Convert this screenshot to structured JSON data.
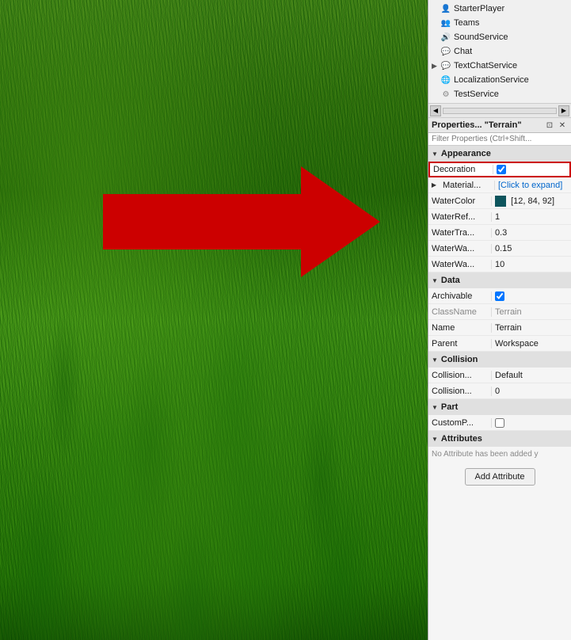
{
  "grass": {
    "alt": "Grass terrain background"
  },
  "explorer": {
    "items": [
      {
        "id": "starterplayer",
        "label": "StarterPlayer",
        "indent": 0,
        "icon": "👤",
        "iconColor": "blue",
        "hasExpand": false
      },
      {
        "id": "teams",
        "label": "Teams",
        "indent": 0,
        "icon": "👥",
        "iconColor": "blue",
        "hasExpand": false
      },
      {
        "id": "soundservice",
        "label": "SoundService",
        "indent": 0,
        "icon": "🔊",
        "iconColor": "blue",
        "hasExpand": false
      },
      {
        "id": "chat",
        "label": "Chat",
        "indent": 0,
        "icon": "💬",
        "iconColor": "blue",
        "hasExpand": false
      },
      {
        "id": "textchatservice",
        "label": "TextChatService",
        "indent": 0,
        "icon": "💬",
        "iconColor": "blue",
        "hasExpand": true,
        "expanded": false
      },
      {
        "id": "localizationservice",
        "label": "LocalizationService",
        "indent": 0,
        "icon": "🌐",
        "iconColor": "blue",
        "hasExpand": false
      },
      {
        "id": "testservice",
        "label": "TestService",
        "indent": 0,
        "icon": "⚙",
        "iconColor": "blue",
        "hasExpand": false
      }
    ]
  },
  "properties_panel": {
    "title": "Properties... \"Terrain\"",
    "filter_placeholder": "Filter Properties (Ctrl+Shift...",
    "collapse_icon": "▼",
    "dock_icon": "⊡",
    "close_icon": "✕",
    "sections": [
      {
        "id": "appearance",
        "label": "Appearance",
        "expanded": true,
        "rows": [
          {
            "id": "decoration",
            "name": "Decoration",
            "value": "",
            "type": "checkbox",
            "checked": true,
            "highlight": true
          },
          {
            "id": "material",
            "name": "Material...",
            "value": "[Click to expand]",
            "type": "expand",
            "valueStyle": "blue"
          },
          {
            "id": "watercolor",
            "name": "WaterColor",
            "value": "[12, 84, 92]",
            "type": "color",
            "colorHex": "#0c545c"
          },
          {
            "id": "waterref",
            "name": "WaterRef...",
            "value": "1",
            "type": "text"
          },
          {
            "id": "watertra",
            "name": "WaterTra...",
            "value": "0.3",
            "type": "text"
          },
          {
            "id": "waterwa1",
            "name": "WaterWa...",
            "value": "0.15",
            "type": "text"
          },
          {
            "id": "waterwa2",
            "name": "WaterWa...",
            "value": "10",
            "type": "text"
          }
        ]
      },
      {
        "id": "data",
        "label": "Data",
        "expanded": true,
        "rows": [
          {
            "id": "archivable",
            "name": "Archivable",
            "value": "",
            "type": "checkbox",
            "checked": true
          },
          {
            "id": "classname",
            "name": "ClassName",
            "value": "Terrain",
            "type": "text",
            "nameStyle": "grayed",
            "valueStyle": "grayed"
          },
          {
            "id": "name",
            "name": "Name",
            "value": "Terrain",
            "type": "text"
          },
          {
            "id": "parent",
            "name": "Parent",
            "value": "Workspace",
            "type": "text"
          }
        ]
      },
      {
        "id": "collision",
        "label": "Collision",
        "expanded": true,
        "rows": [
          {
            "id": "collisiontype",
            "name": "Collision...",
            "value": "Default",
            "type": "text"
          },
          {
            "id": "collisionval",
            "name": "Collision...",
            "value": "0",
            "type": "text"
          }
        ]
      },
      {
        "id": "part",
        "label": "Part",
        "expanded": true,
        "rows": [
          {
            "id": "customp",
            "name": "CustomP...",
            "value": "",
            "type": "checkbox",
            "checked": false
          }
        ]
      },
      {
        "id": "attributes",
        "label": "Attributes",
        "expanded": true,
        "rows": []
      }
    ],
    "no_attribute_text": "No Attribute has been added y",
    "add_attribute_label": "Add Attribute"
  }
}
